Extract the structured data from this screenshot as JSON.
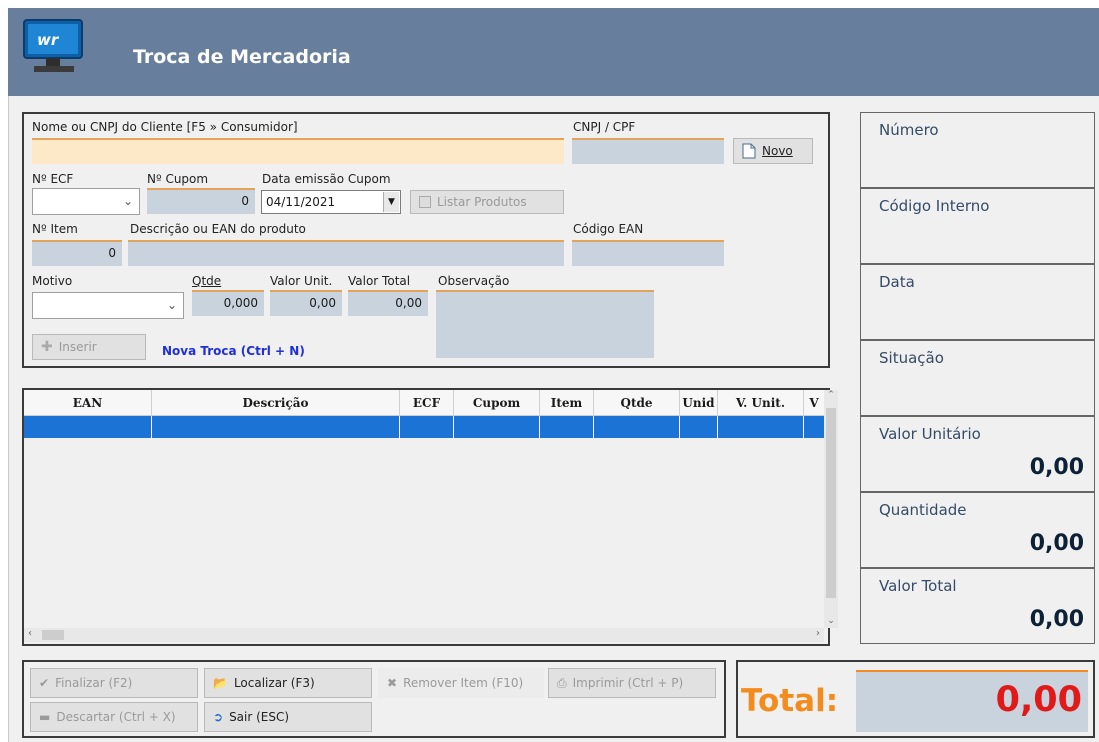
{
  "window": {
    "title": "Troca de Mercadoria"
  },
  "form": {
    "cliente_label": "Nome ou CNPJ do Cliente [F5 » Consumidor]",
    "cnpj_label": "CNPJ / CPF",
    "novo_label": "Novo",
    "ecf_label": "Nº ECF",
    "cupom_label": "Nº Cupom",
    "cupom_value": "0",
    "data_label": "Data emissão Cupom",
    "data_value": "04/11/2021",
    "listar_label": "Listar Produtos",
    "item_label": "Nº Item",
    "item_value": "0",
    "descricao_label": "Descrição ou EAN do produto",
    "ean_label": "Código EAN",
    "motivo_label": "Motivo",
    "qtde_label": "Qtde",
    "qtde_value": "0,000",
    "valor_unit_label": "Valor Unit.",
    "valor_unit_value": "0,00",
    "valor_total_label": "Valor Total",
    "valor_total_value": "0,00",
    "observacao_label": "Observação",
    "inserir_label": "Inserir",
    "nova_troca_label": "Nova Troca (Ctrl + N)"
  },
  "grid": {
    "columns": [
      "EAN",
      "Descrição",
      "ECF",
      "Cupom",
      "Item",
      "Qtde",
      "Unid",
      "V. Unit.",
      "V"
    ]
  },
  "side": {
    "numero_label": "Número",
    "codigo_label": "Código Interno",
    "data_label": "Data",
    "situacao_label": "Situação",
    "valor_unitario_label": "Valor Unitário",
    "valor_unitario_value": "0,00",
    "quantidade_label": "Quantidade",
    "quantidade_value": "0,00",
    "valor_total_label": "Valor Total",
    "valor_total_value": "0,00"
  },
  "actions": {
    "finalizar": "Finalizar (F2)",
    "localizar": "Localizar (F3)",
    "remover": "Remover Item (F10)",
    "imprimir": "Imprimir (Ctrl + P)",
    "descartar": "Descartar (Ctrl + X)",
    "sair": "Sair (ESC)"
  },
  "total": {
    "label": "Total:",
    "value": "0,00"
  },
  "colors": {
    "titlebar": "#677f9d",
    "accent_orange": "#f28c1e",
    "total_red": "#e01919",
    "selection_blue": "#1c73d6",
    "link_blue": "#1f2fd6"
  }
}
